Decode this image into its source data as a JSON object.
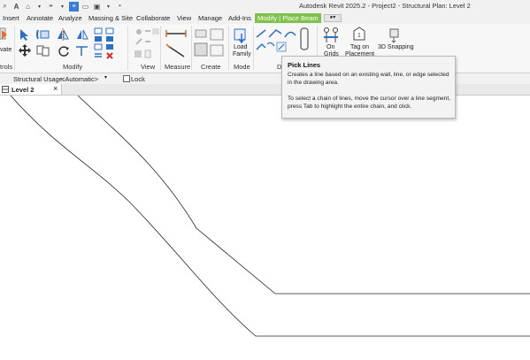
{
  "app": {
    "title": "Autodesk Revit 2025.2 - Project2 - Structural Plan: Level 2"
  },
  "tabs": [
    {
      "label": "Insert"
    },
    {
      "label": "Annotate"
    },
    {
      "label": "Analyze"
    },
    {
      "label": "Massing & Site"
    },
    {
      "label": "Collaborate"
    },
    {
      "label": "View"
    },
    {
      "label": "Manage"
    },
    {
      "label": "Add-Ins"
    },
    {
      "label": "Modify | Place Beam"
    }
  ],
  "ribbon": {
    "panels": {
      "controls": "trols",
      "modify": "Modify",
      "view": "View",
      "measure": "Measure",
      "create": "Create",
      "mode": "Mode",
      "draw": "Dr"
    },
    "activate_label": "vate",
    "load_family_label": [
      "Load",
      "Family"
    ],
    "on_grids_label": [
      "On",
      "Grids"
    ],
    "tag_on_placement_label": [
      "Tag on",
      "Placement"
    ],
    "snapping_label": "3D Snapping"
  },
  "options_bar": {
    "structural_usage_label": "Structural Usage:",
    "structural_usage_value": "<Automatic>",
    "lock_label": "Lock"
  },
  "view_tab": {
    "label": "Level 2"
  },
  "tooltip": {
    "title": "Pick Lines",
    "description": "Creates a line based on an existing wall, line, or edge selected in the drawing area.",
    "hint": "To select a chain of lines, move the cursor over a line segment, press Tab to highlight the entire chain, and click."
  },
  "colors": {
    "active_tab": "#7ec14b",
    "ribbon_blue": "#2e6fc4"
  }
}
